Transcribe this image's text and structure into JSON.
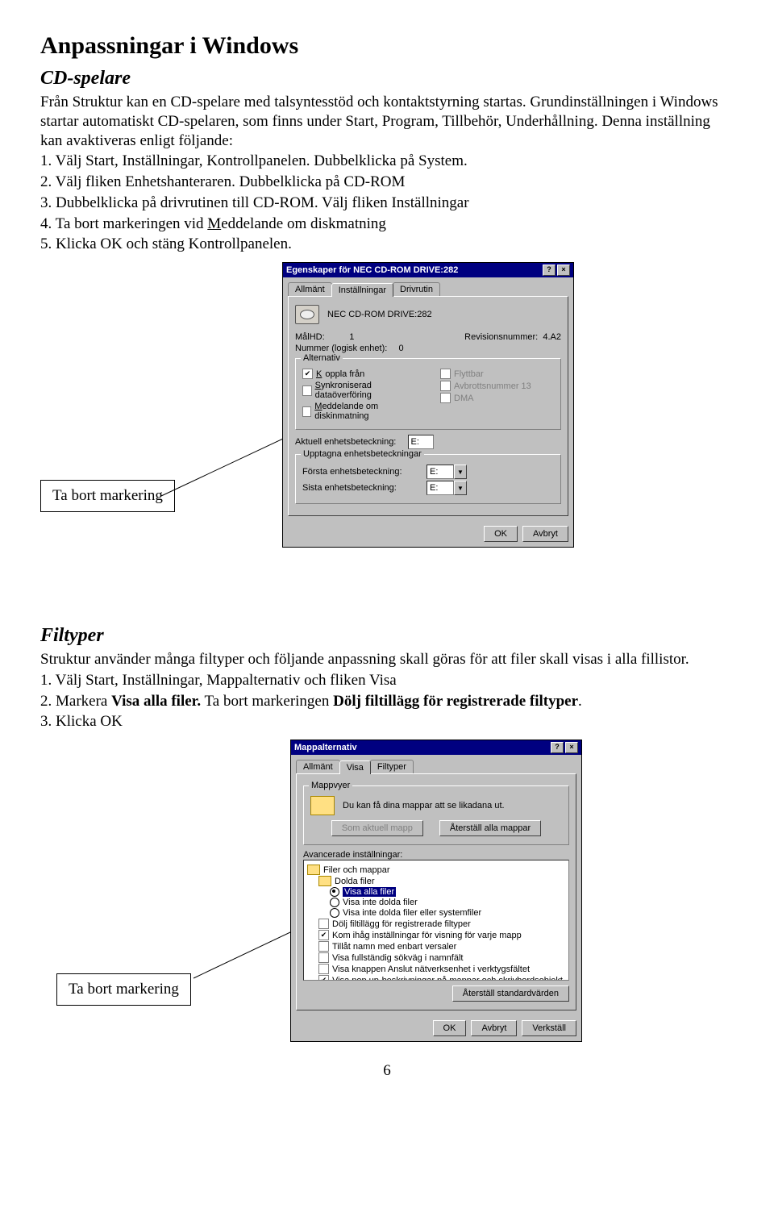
{
  "heading": "Anpassningar i Windows",
  "cd": {
    "title": "CD-spelare",
    "p1": "Från Struktur kan en CD-spelare med talsyntesstöd och kontaktstyrning startas. Grundinställningen i Windows startar automatiskt CD-spelaren, som finns under Start, Program, Tillbehör, Underhållning. Denna inställning kan avaktiveras enligt följande:",
    "steps": {
      "s1": "Välj Start, Inställningar, Kontrollpanelen. Dubbelklicka på System.",
      "s2": "Välj fliken Enhetshanteraren. Dubbelklicka på CD-ROM",
      "s3": "Dubbelklicka på drivrutinen till CD-ROM. Välj fliken Inställningar",
      "s4": "Ta bort markeringen vid  Meddelande om diskmatning",
      "s5": "Klicka OK och stäng Kontrollpanelen."
    },
    "callout": "Ta bort markering",
    "n1": "1.  ",
    "n2": "2.  ",
    "n3": "3.  ",
    "n4": "4.  ",
    "n5": "5.  "
  },
  "win1": {
    "title": "Egenskaper för NEC CD-ROM DRIVE:282",
    "tabs": {
      "t1": "Allmänt",
      "t2": "Inställningar",
      "t3": "Drivrutin"
    },
    "device": "NEC CD-ROM DRIVE:282",
    "malhd_label": "MålHD:",
    "malhd_val": "1",
    "rev_label": "Revisionsnummer:",
    "rev_val": "4.A2",
    "num_label": "Nummer (logisk enhet):",
    "num_val": "0",
    "grp_alt": "Alternativ",
    "opt_koppla": "Koppla från",
    "opt_flytt": "Flyttbar",
    "opt_synk": "Synkroniserad dataöverföring",
    "opt_avbrott": "Avbrottsnummer 13",
    "opt_medd": "Meddelande om diskinmatning",
    "opt_dma": "DMA",
    "cur_label": "Aktuell enhetsbeteckning:",
    "cur_val": "E:",
    "grp_res": "Upptagna enhetsbeteckningar",
    "first_label": "Första enhetsbeteckning:",
    "last_label": "Sista enhetsbeteckning:",
    "ev": "E:",
    "ok": "OK",
    "cancel": "Avbryt"
  },
  "filt": {
    "title": "Filtyper",
    "p1": "Struktur använder många filtyper och följande anpassning skall göras för att filer skall visas i alla fillistor.",
    "steps": {
      "s1": "Välj Start, Inställningar, Mappalternativ och fliken Visa",
      "s2a": "Markera ",
      "s2b": "Visa alla filer.",
      "s2c": "  Ta bort markeringen ",
      "s2d": "Dölj filtillägg för registrerade filtyper",
      "s2e": ".",
      "s3": "Klicka OK"
    },
    "callout": "Ta bort markering",
    "n1": "1.  ",
    "n2": "2.  ",
    "n3": "3.  "
  },
  "win2": {
    "title": "Mappalternativ",
    "tabs": {
      "t1": "Allmänt",
      "t2": "Visa",
      "t3": "Filtyper"
    },
    "grp_map": "Mappvyer",
    "map_text": "Du kan få dina mappar att se likadana ut.",
    "btn_set": "Som aktuell mapp",
    "btn_reset": "Återställ alla mappar",
    "grp_adv": "Avancerade inställningar:",
    "nodes": {
      "root": "Filer och mappar",
      "dolda": "Dolda filer",
      "r1": "Visa alla filer",
      "r2": "Visa inte dolda filer",
      "r3": "Visa inte dolda filer eller systemfiler",
      "c1": "Dölj filtillägg för registrerade filtyper",
      "c2": "Kom ihåg inställningar för visning för varje mapp",
      "c3": "Tillåt namn med enbart versaler",
      "c4": "Visa fullständig sökväg i namnfält",
      "c5": "Visa knappen Anslut nätverksenhet i verktygsfältet",
      "c6": "Visa pop up-beskrivningar på mappar och skrivbordsobjekt"
    },
    "btn_std": "Återställ standardvärden",
    "ok": "OK",
    "cancel": "Avbryt",
    "apply": "Verkställ"
  },
  "pagenum": "6"
}
